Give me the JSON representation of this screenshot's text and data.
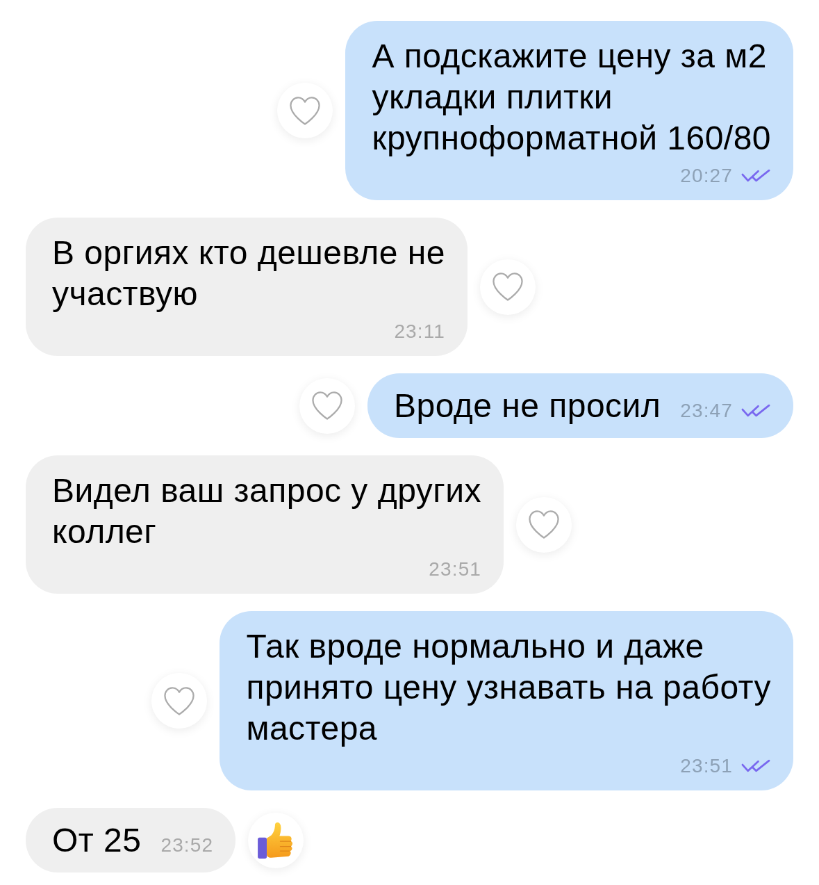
{
  "messages": [
    {
      "kind": "outgoing",
      "text": "А подскажите цену за м2\nукладки плитки\nкрупноформатной 160/80",
      "time": "20:27",
      "read": true,
      "reaction": {
        "kind": "heart"
      }
    },
    {
      "kind": "incoming",
      "text": "В оргиях кто дешевле не\nучаствую",
      "time": "23:11",
      "reaction": {
        "kind": "heart"
      }
    },
    {
      "kind": "outgoing",
      "text": "Вроде не просил",
      "time": "23:47",
      "read": true,
      "reaction": {
        "kind": "heart"
      }
    },
    {
      "kind": "incoming",
      "text": "Видел ваш запрос у других\nколлег",
      "time": "23:51",
      "reaction": {
        "kind": "heart"
      }
    },
    {
      "kind": "outgoing",
      "text": "Так вроде нормально и даже\nпринято цену узнавать на работу\nмастера",
      "time": "23:51",
      "read": true,
      "reaction": {
        "kind": "heart"
      }
    },
    {
      "kind": "incoming",
      "text": "От 25",
      "time": "23:52",
      "reaction": {
        "kind": "thumbs_up"
      }
    }
  ]
}
